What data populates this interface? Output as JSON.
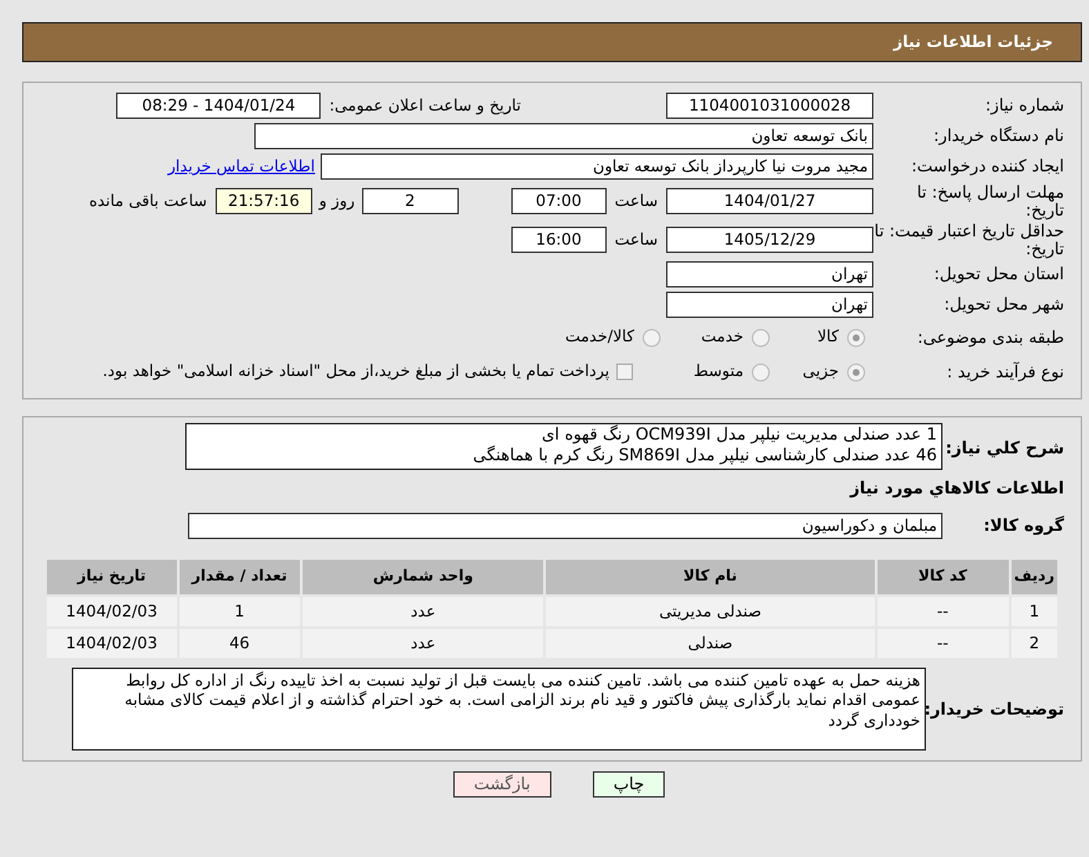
{
  "header": {
    "title": "جزئیات اطلاعات نیاز"
  },
  "details": {
    "need_number": {
      "label": "شماره نیاز:",
      "value": "1104001031000028"
    },
    "announce": {
      "label": "تاریخ و ساعت اعلان عمومی:",
      "value": "1404/01/24 - 08:29"
    },
    "buyer_org": {
      "label": "نام دستگاه خریدار:",
      "value": "بانک توسعه تعاون"
    },
    "requester": {
      "label": "ایجاد کننده درخواست:",
      "value": "مجید مروت نیا کارپرداز بانک توسعه تعاون",
      "link": "اطلاعات تماس خریدار"
    },
    "deadline": {
      "label": "مهلت ارسال پاسخ: تا تاریخ:",
      "date": "1404/01/27",
      "time_label": "ساعت",
      "time": "07:00",
      "days": "2",
      "days_label": "روز و",
      "remaining": "21:57:16",
      "remaining_label": "ساعت باقی مانده"
    },
    "validity": {
      "label": "حداقل تاریخ اعتبار قیمت: تا تاریخ:",
      "date": "1405/12/29",
      "time_label": "ساعت",
      "time": "16:00"
    },
    "province": {
      "label": "استان محل تحویل:",
      "value": "تهران"
    },
    "city": {
      "label": "شهر محل تحویل:",
      "value": "تهران"
    },
    "category": {
      "label": "طبقه بندی موضوعی:",
      "options": [
        {
          "label": "کالا",
          "selected": true
        },
        {
          "label": "خدمت",
          "selected": false
        },
        {
          "label": "کالا/خدمت",
          "selected": false
        }
      ]
    },
    "process": {
      "label": "نوع فرآیند خرید :",
      "options": [
        {
          "label": "جزیی",
          "selected": true
        },
        {
          "label": "متوسط",
          "selected": false
        }
      ],
      "treasury": {
        "label": "پرداخت تمام یا بخشی از مبلغ خرید،از محل \"اسناد خزانه اسلامی\" خواهد بود.",
        "checked": false
      }
    }
  },
  "summary": {
    "label": "شرح کلي نياز:",
    "lines": [
      "1 عدد صندلی مدیریت نیلپر مدل OCM939I رنگ قهوه ای",
      "46 عدد صندلی کارشناسی نیلپر مدل SM869I رنگ کرم با هماهنگی"
    ]
  },
  "goods_title": "اطلاعات کالاهاي مورد نياز",
  "goods_group": {
    "label": "گروه کالا:",
    "value": "مبلمان و دکوراسیون"
  },
  "table": {
    "columns": [
      "ردیف",
      "کد کالا",
      "نام کالا",
      "واحد شمارش",
      "تعداد / مقدار",
      "تاریخ نیاز"
    ],
    "rows": [
      [
        "1",
        "--",
        "صندلی مدیریتی",
        "عدد",
        "1",
        "1404/02/03"
      ],
      [
        "2",
        "--",
        "صندلی",
        "عدد",
        "46",
        "1404/02/03"
      ]
    ]
  },
  "notes": {
    "label": "توضیحات خریدار:",
    "value": "هزینه حمل به عهده تامین کننده می باشد. تامین کننده می بایست قبل از تولید نسبت به اخذ تاییده رنگ از اداره کل روابط عمومی اقدام نماید بارگذاری پیش فاکتور و قید نام برند الزامی است. به خود احترام گذاشته و از اعلام قیمت کالای مشابه خودداری گردد"
  },
  "buttons": [
    {
      "kind": "print",
      "label": "چاپ"
    },
    {
      "kind": "back",
      "label": "بازگشت"
    }
  ]
}
